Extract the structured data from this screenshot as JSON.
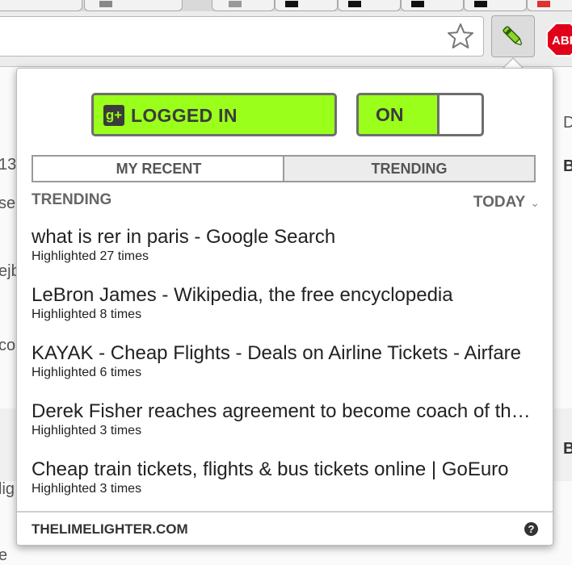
{
  "popup": {
    "login_label": "LOGGED IN",
    "toggle_label": "ON",
    "tabs": [
      "MY RECENT",
      "TRENDING"
    ],
    "active_tab": "TRENDING",
    "section_title": "TRENDING",
    "period_label": "TODAY",
    "items": [
      {
        "title": "what is rer in paris - Google Search",
        "count": "Highlighted 27 times"
      },
      {
        "title": "LeBron James - Wikipedia, the free encyclopedia",
        "count": "Highlighted 8 times"
      },
      {
        "title": "KAYAK - Cheap Flights - Deals on Airline Tickets - Airfare",
        "count": "Highlighted 6 times"
      },
      {
        "title": "Derek Fisher reaches agreement to become coach of the Knicks",
        "count": "Highlighted 3 times"
      },
      {
        "title": "Cheap train tickets, flights & bus tickets online | GoEuro",
        "count": "Highlighted 3 times"
      }
    ],
    "footer_link": "THELIMELIGHTER.COM",
    "help_glyph": "?"
  },
  "toolbar": {
    "bookmark_icon": "star-icon",
    "extension_icon": "highlighter-pen-icon",
    "adblock_label": "ABP"
  },
  "background": {
    "left_fragments": [
      "13",
      "se",
      "ejb",
      "co",
      "lig",
      "e"
    ],
    "right_fragments": [
      "D",
      "B",
      "B"
    ]
  },
  "colors": {
    "accent_green": "#9aff1a",
    "dark_gray": "#3b3b3b",
    "border_gray": "#6e6e6e",
    "adblock_red": "#e0001a"
  }
}
